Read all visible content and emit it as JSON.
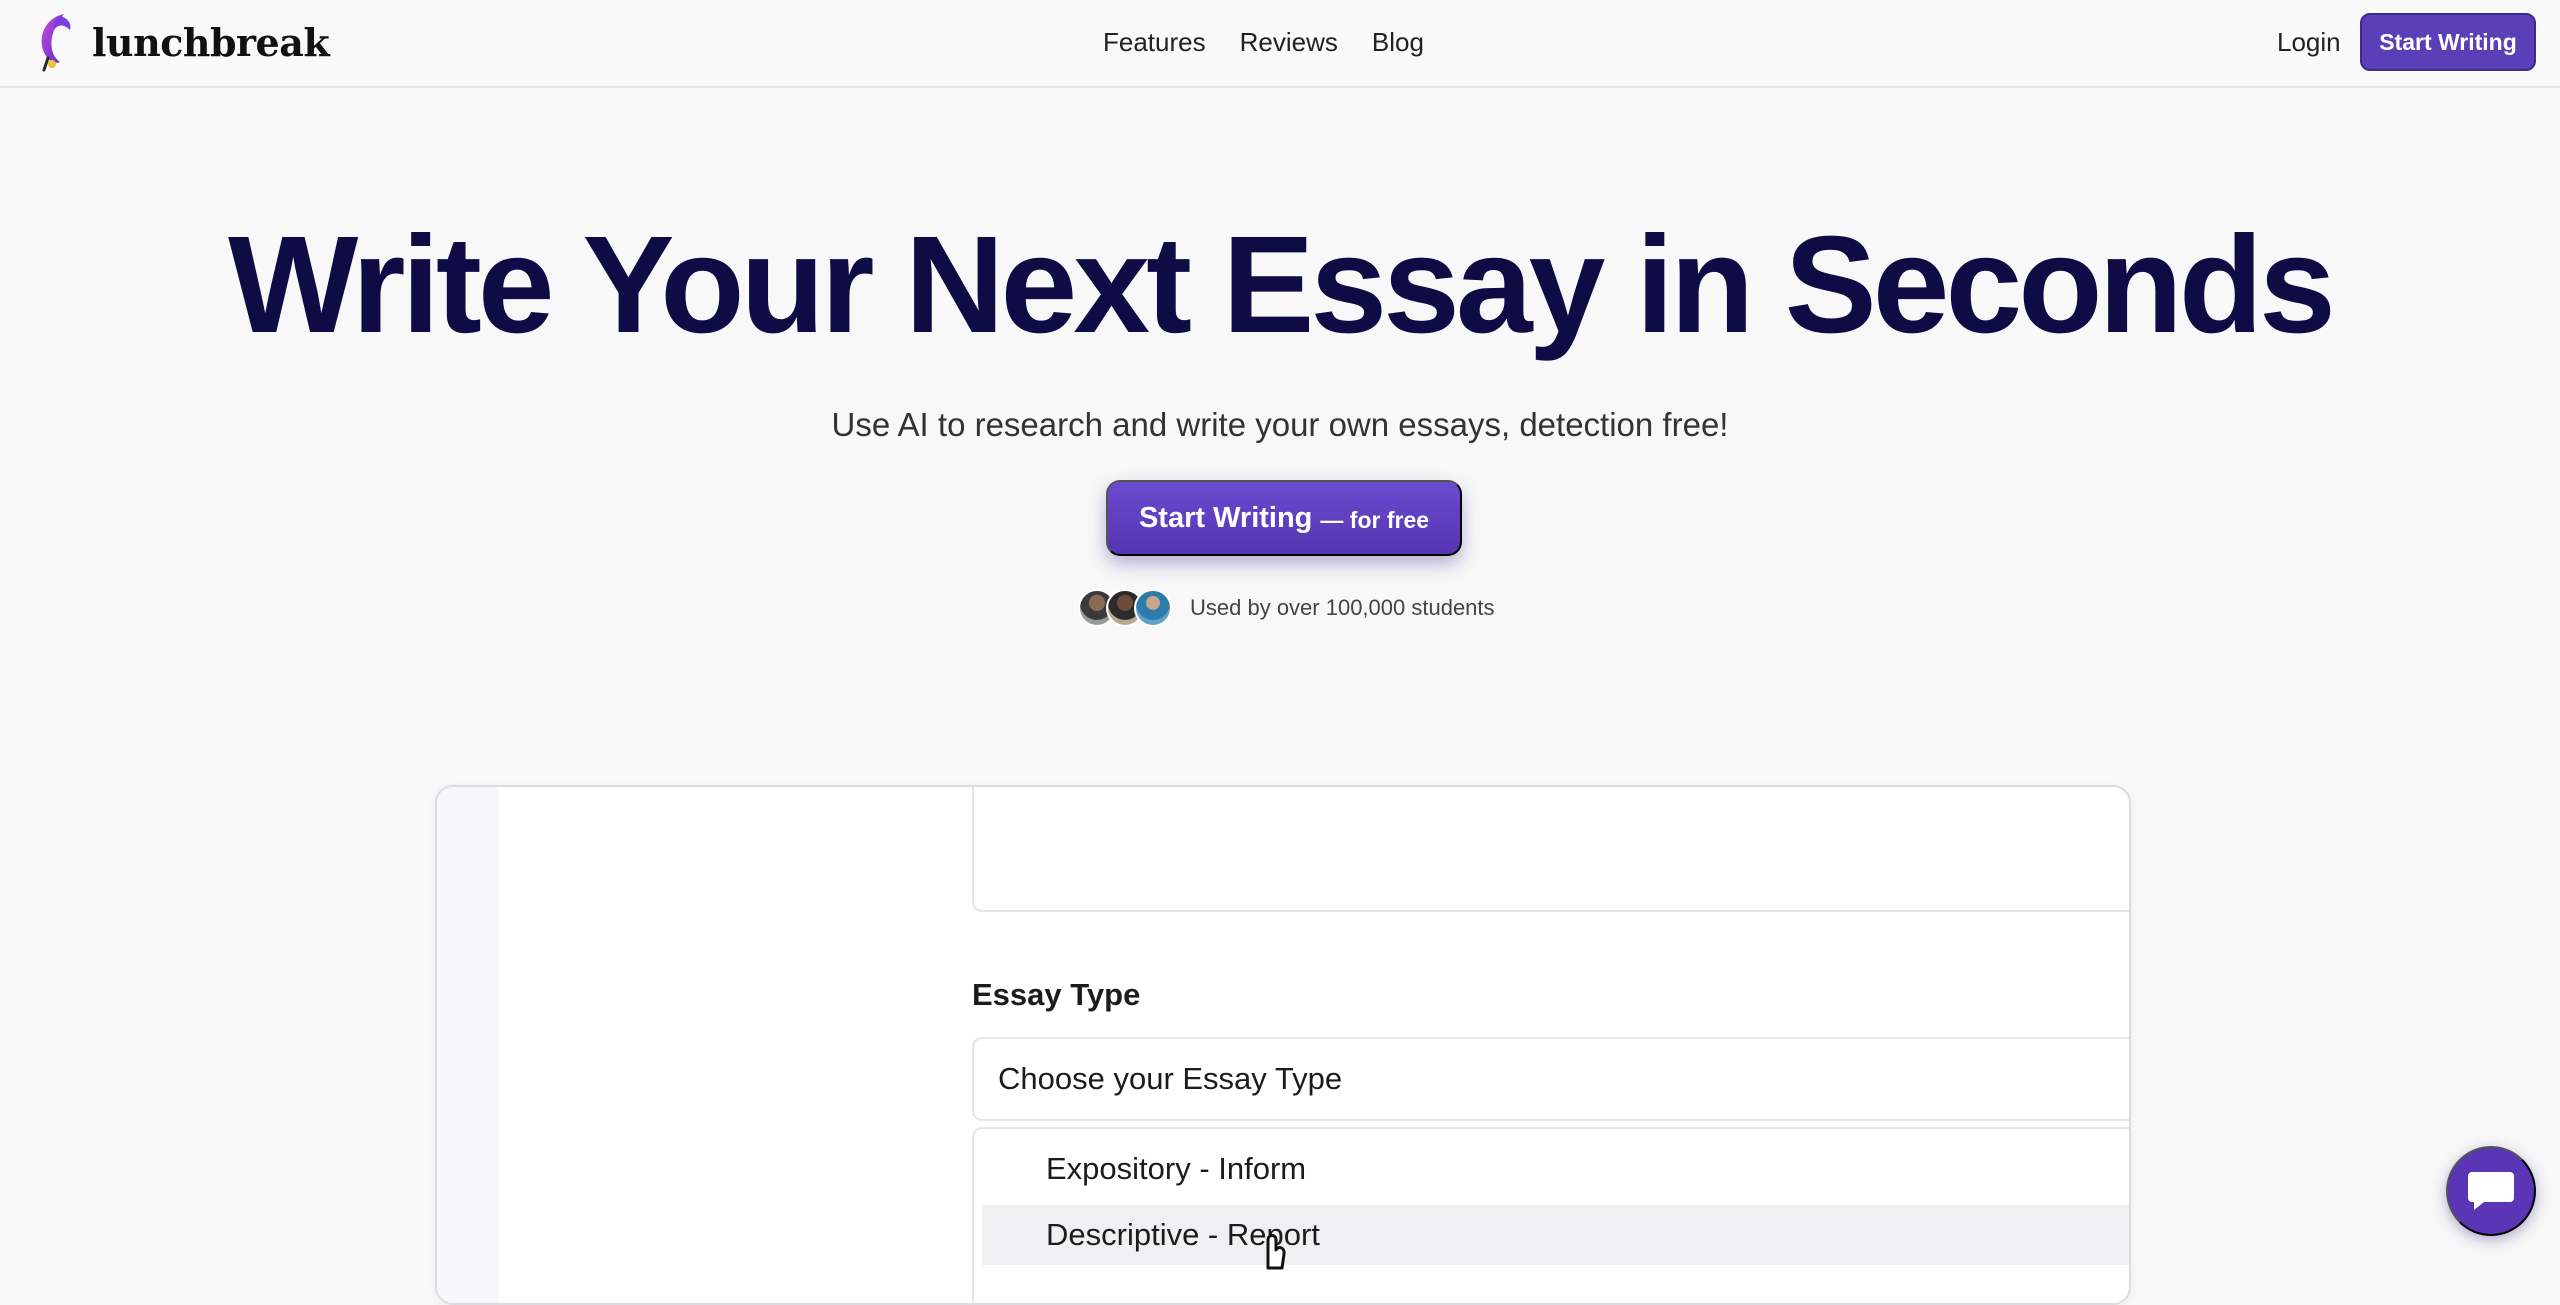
{
  "brand": {
    "name": "lunchbreak",
    "logo_icon": "feather-quill-icon"
  },
  "nav": {
    "links": [
      "Features",
      "Reviews",
      "Blog"
    ],
    "login": "Login",
    "cta": "Start Writing"
  },
  "hero": {
    "title": "Write Your Next Essay in Seconds",
    "subtitle": "Use AI to research and write your own essays, detection free!",
    "cta_main": "Start Writing",
    "cta_suffix": "— for free",
    "social_proof": "Used by over 100,000 students"
  },
  "demo": {
    "essay_type_label": "Essay Type",
    "select_placeholder": "Choose your Essay Type",
    "options": [
      "Expository - Inform",
      "Descriptive - Report"
    ],
    "highlighted_option": "Descriptive - Report"
  },
  "chat": {
    "icon": "chat-bubble-icon"
  },
  "colors": {
    "accent": "#5b3fb8",
    "title": "#0f0c45",
    "background": "#f8f8f8"
  }
}
